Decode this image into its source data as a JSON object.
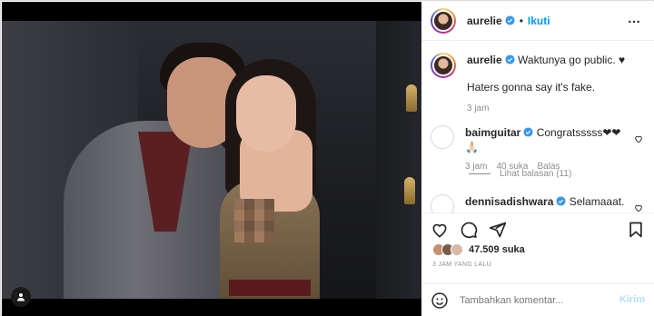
{
  "post": {
    "username": "aurelie",
    "follow_label": "Ikuti",
    "dot": "•",
    "caption_line1": "Waktunya go public. ♥",
    "caption_line2": "Haters gonna say it's fake.",
    "caption_time": "3 jam"
  },
  "comments": [
    {
      "username": "baimguitar",
      "text": "Congratsssss❤❤🙏🏻",
      "time": "3 jam",
      "likes": "40 suka",
      "reply": "Balas"
    },
    {
      "username": "dennisadishwara",
      "text": "Selamaaat."
    }
  ],
  "replies_label": "Lihat balasan (11)",
  "engagement": {
    "likes": "47.509 suka",
    "timestamp": "3 JAM YANG LALU"
  },
  "composer": {
    "placeholder": "Tambahkan komentar...",
    "post_label": "Kirim"
  },
  "colors": {
    "accent": "#0095f6",
    "verified": "#3897f0",
    "muted": "#8e8e8e"
  },
  "icons": [
    "verified-icon",
    "more-icon",
    "heart-icon",
    "comment-icon",
    "share-icon",
    "bookmark-icon",
    "emoji-icon",
    "user-tag-icon"
  ]
}
